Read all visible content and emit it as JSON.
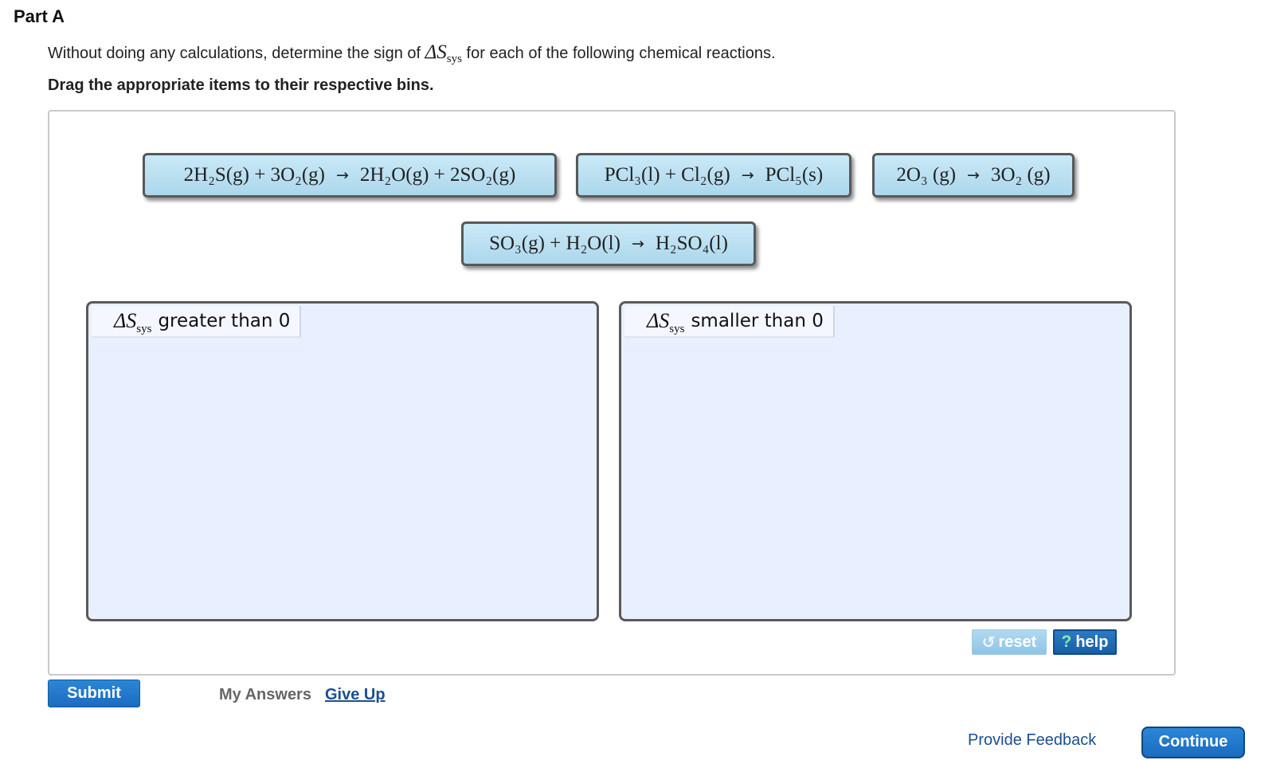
{
  "part": {
    "title": "Part A"
  },
  "instruction": {
    "before": "Without doing any calculations, determine the sign of ",
    "symbol": "ΔS",
    "symbol_sub": "sys",
    "after": " for each of the following chemical reactions."
  },
  "drag_instruction": "Drag the appropriate items to their respective bins.",
  "tiles": {
    "t1": {
      "lhs": "2H₂S(g) + 3O₂(g)",
      "arrow": "→",
      "rhs": "2H₂O(g) + 2SO₂(g)"
    },
    "t2": {
      "lhs": "PCl₃(l) + Cl₂(g)",
      "arrow": "→",
      "rhs": "PCl₅(s)"
    },
    "t3": {
      "lhs": "2O₃ (g)",
      "arrow": "→",
      "rhs": "3O₂ (g)"
    },
    "t4": {
      "lhs": "SO₃(g) + H₂O(l)",
      "arrow": "→",
      "rhs": "H₂SO₄(l)"
    }
  },
  "bins": {
    "greater": {
      "symbol": "ΔS",
      "symbol_sub": "sys",
      "label": "greater than 0"
    },
    "smaller": {
      "symbol": "ΔS",
      "symbol_sub": "sys",
      "label": "smaller than 0"
    }
  },
  "controls": {
    "reset_label": "reset",
    "help_label": "help",
    "reset_icon": "↺",
    "help_icon": "?"
  },
  "footer": {
    "submit_label": "Submit",
    "my_answers_label": "My Answers",
    "give_up_label": "Give Up",
    "feedback_label": "Provide Feedback",
    "continue_label": "Continue"
  }
}
